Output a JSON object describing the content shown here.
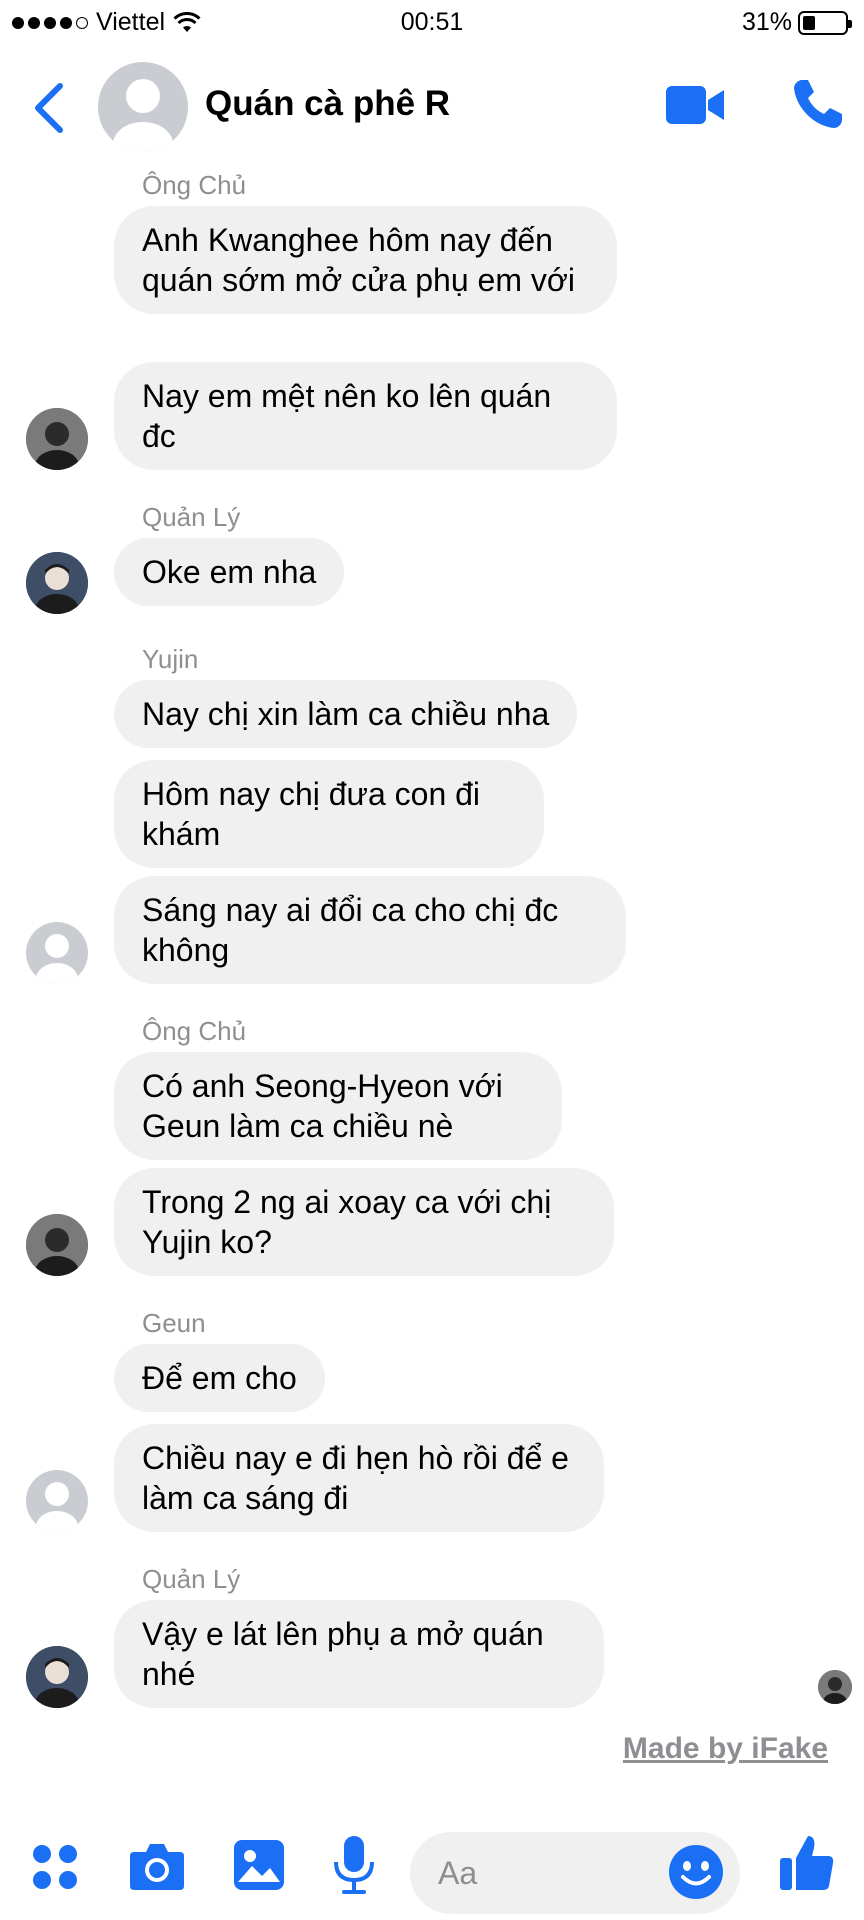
{
  "status_bar": {
    "carrier": "Viettel",
    "time": "00:51",
    "battery": "31%",
    "battery_level": 0.31
  },
  "header": {
    "title": "Quán cà phê R"
  },
  "messages": [
    {
      "sender": "Ông Chủ",
      "bubbles": [
        "Anh Kwanghee hôm nay đến quán sớm mở cửa phụ em với",
        "Nay em mệt nên ko lên quán đc"
      ]
    },
    {
      "sender": "Quản Lý",
      "bubbles": [
        "Oke em nha"
      ]
    },
    {
      "sender": "Yujin",
      "bubbles": [
        "Nay chị xin làm ca chiều nha",
        "Hôm nay chị đưa con đi khám",
        "Sáng nay ai đổi ca cho chị đc không"
      ]
    },
    {
      "sender": "Ông Chủ",
      "bubbles": [
        "Có anh Seong-Hyeon với Geun làm ca chiều nè",
        "Trong 2 ng ai xoay ca với chị Yujin ko?"
      ]
    },
    {
      "sender": "Geun",
      "bubbles": [
        "Để em cho",
        "Chiều nay e đi hẹn hò rồi để e làm ca sáng đi"
      ]
    },
    {
      "sender": "Quản Lý",
      "bubbles": [
        "Vậy e lát lên phụ a mở quán nhé"
      ]
    }
  ],
  "watermark": "Made by iFake",
  "composer": {
    "placeholder": "Aa"
  },
  "colors": {
    "accent": "#1a6ff5",
    "bubble": "#f0f0f0",
    "meta_text": "#8e8e93"
  },
  "icons": [
    "menu-dots-icon",
    "camera-icon",
    "photo-icon",
    "microphone-icon",
    "emoji-icon",
    "thumbs-up-icon",
    "video-call-icon",
    "phone-icon",
    "back-chevron-icon",
    "wifi-icon"
  ]
}
